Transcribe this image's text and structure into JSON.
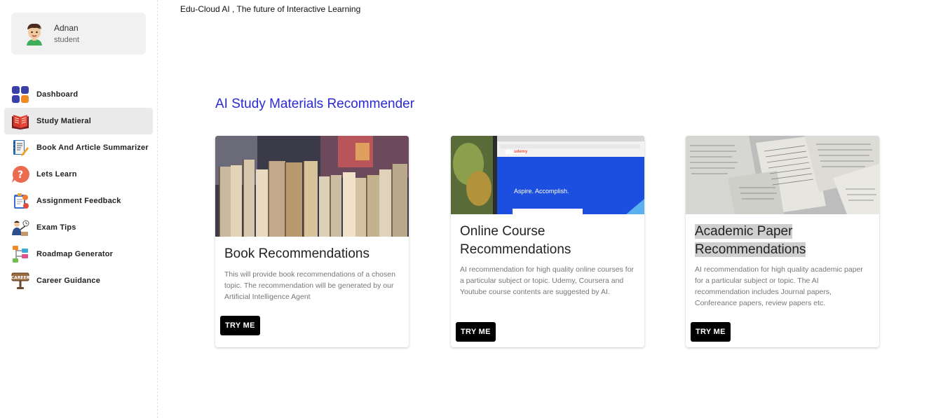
{
  "topbar": {
    "text": "Edu-Cloud AI , The future of Interactive Learning"
  },
  "profile": {
    "name": "Adnan",
    "role": "student"
  },
  "sidebar": {
    "items": [
      {
        "label": "Dashboard",
        "icon": "dashboard-icon",
        "active": false
      },
      {
        "label": "Study Matieral",
        "icon": "open-book-icon",
        "active": true
      },
      {
        "label": "Book And Article Summarizer",
        "icon": "notebook-pencil-icon",
        "active": false
      },
      {
        "label": "Lets Learn",
        "icon": "question-bubble-icon",
        "active": false
      },
      {
        "label": "Assignment Feedback",
        "icon": "assignment-icon",
        "active": false
      },
      {
        "label": "Exam Tips",
        "icon": "teacher-icon",
        "active": false
      },
      {
        "label": "Roadmap Generator",
        "icon": "roadmap-icon",
        "active": false
      },
      {
        "label": "Career Guidance",
        "icon": "career-sign-icon",
        "active": false
      }
    ]
  },
  "main": {
    "title": "AI Study Materials Recommender",
    "cards": [
      {
        "title": "Book Recommendations",
        "description": "This will provide book recommendations of a chosen topic. The recommendation will be generated by our Artificial Intelligence Agent",
        "button": "TRY ME",
        "image": "books-on-shelf"
      },
      {
        "title": "Online Course Recommendations",
        "description": "AI recommendation for high quality online courses for a particular subject or topic. Udemy, Coursera and Youtube course contents are suggested by AI.",
        "button": "TRY ME",
        "image": "udemy-browser-screen",
        "image_text": {
          "brand": "udemy",
          "headline": "Aspire. Accomplish."
        }
      },
      {
        "title": "Academic Paper Recommendations",
        "description": "AI recommendation for high quality academic paper for a particular subject or topic. The AI recommendation includes Journal papers, Confereance papers, review papers etc.",
        "button": "TRY ME",
        "image": "scattered-paper-pages"
      }
    ]
  },
  "colors": {
    "title_blue": "#2a2ad6",
    "button_black": "#000000",
    "active_nav": "#eaeaea"
  }
}
